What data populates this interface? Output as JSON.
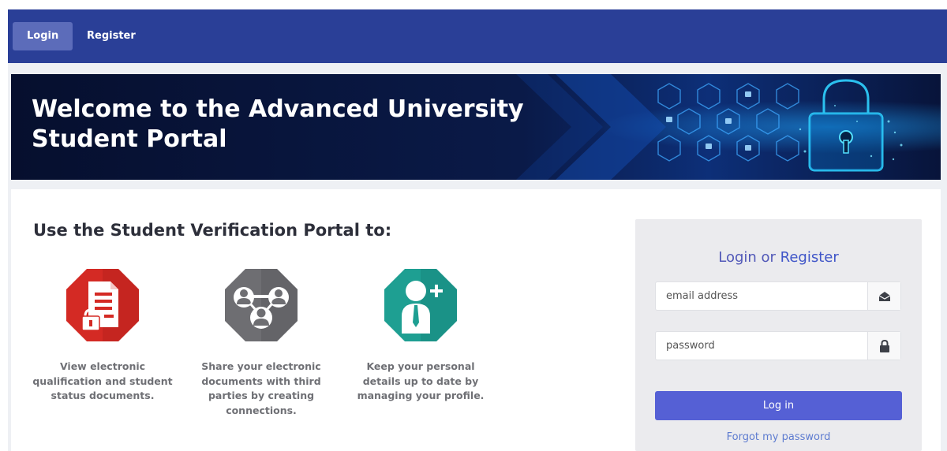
{
  "nav": {
    "login_label": "Login",
    "register_label": "Register"
  },
  "banner": {
    "title": "Welcome to the Advanced University Student Portal"
  },
  "features": {
    "heading": "Use the Student Verification Portal to:",
    "items": [
      {
        "icon": "document-lock-icon",
        "color": "#d42a24",
        "text": "View electronic qualification and student status documents."
      },
      {
        "icon": "connections-icon",
        "color": "#6e6e72",
        "text": "Share your electronic documents with third parties by creating connections."
      },
      {
        "icon": "add-user-icon",
        "color": "#1e9f92",
        "text": "Keep your personal details up to date by managing your profile."
      }
    ]
  },
  "login": {
    "title_prefix": "Login or ",
    "title_register": "Register",
    "email_placeholder": "email address",
    "password_placeholder": "password",
    "button_label": "Log in",
    "forgot_label": "Forgot my password"
  },
  "colors": {
    "navbar": "#2a3f97",
    "banner": "#071233",
    "login_button": "#5560d5",
    "link": "#5d7bd0"
  }
}
